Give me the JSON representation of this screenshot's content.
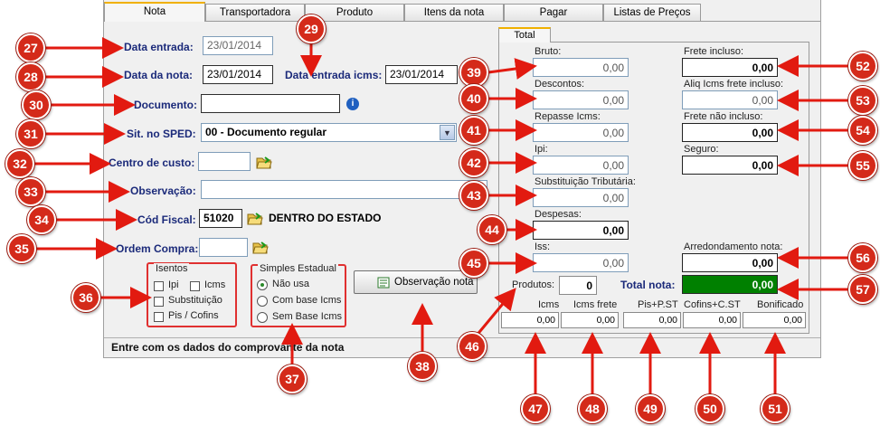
{
  "tabs": [
    "Nota",
    "Transportadora",
    "Produto",
    "Itens da nota",
    "Pagar",
    "Listas de Preços"
  ],
  "total_tab": "Total",
  "left": {
    "data_entrada_label": "Data entrada:",
    "data_entrada_value": "23/01/2014",
    "data_nota_label": "Data da nota:",
    "data_nota_value": "23/01/2014",
    "data_icms_label": "Data entrada icms:",
    "data_icms_value": "23/01/2014",
    "documento_label": "Documento:",
    "documento_value": "",
    "sped_label": "Sit. no SPED:",
    "sped_value": "00 - Documento regular",
    "centro_label": "Centro de custo:",
    "centro_value": "",
    "obs_label": "Observação:",
    "obs_value": "",
    "cfop_label": "Cód Fiscal:",
    "cfop_value": "51020",
    "cfop_desc": "DENTRO DO ESTADO",
    "ordem_label": "Ordem Compra:",
    "ordem_value": ""
  },
  "isentos": {
    "title": "Isentos",
    "ipi": "Ipi",
    "icms": "Icms",
    "substituicao": "Substituição",
    "pis_cofins": "Pis / Cofins"
  },
  "simples": {
    "title": "Simples Estadual",
    "opt1": "Não usa",
    "opt2": "Com base Icms",
    "opt3": "Sem Base Icms"
  },
  "obs_button": "Observação nota",
  "totals": {
    "bruto_label": "Bruto:",
    "bruto": "0,00",
    "descontos_label": "Descontos:",
    "descontos": "0,00",
    "repasse_label": "Repasse Icms:",
    "repasse": "0,00",
    "ipi_label": "Ipi:",
    "ipi": "0,00",
    "subst_label": "Substituição Tributária:",
    "subst": "0,00",
    "despesas_label": "Despesas:",
    "despesas": "0,00",
    "iss_label": "Iss:",
    "iss": "0,00",
    "frete_incl_label": "Frete incluso:",
    "frete_incl": "0,00",
    "aliq_label": "Aliq Icms frete incluso:",
    "aliq": "0,00",
    "frete_nao_label": "Frete não incluso:",
    "frete_nao": "0,00",
    "seguro_label": "Seguro:",
    "seguro": "0,00",
    "arred_label": "Arredondamento nota:",
    "arred": "0,00",
    "produtos_label": "Produtos:",
    "produtos": "0",
    "total_label": "Total nota:",
    "total": "0,00",
    "icms_label": "Icms",
    "icms": "0,00",
    "icms_frete_label": "Icms frete",
    "icms_frete": "0,00",
    "pis_label": "Pis+P.ST",
    "pis": "0,00",
    "cofins_label": "Cofins+C.ST",
    "cofins": "0,00",
    "bonif_label": "Bonificado",
    "bonif": "0,00"
  },
  "status_text": "Entre com os dados do comprovante da nota",
  "callouts": [
    "27",
    "28",
    "29",
    "30",
    "31",
    "32",
    "33",
    "34",
    "35",
    "36",
    "37",
    "38",
    "39",
    "40",
    "41",
    "42",
    "43",
    "44",
    "45",
    "46",
    "47",
    "48",
    "49",
    "50",
    "51",
    "52",
    "53",
    "54",
    "55",
    "56",
    "57"
  ],
  "colors": {
    "callout": "#d42a1a",
    "label": "#1b2a7a",
    "total_bg": "#008000",
    "tab_accent": "#f0b000"
  }
}
